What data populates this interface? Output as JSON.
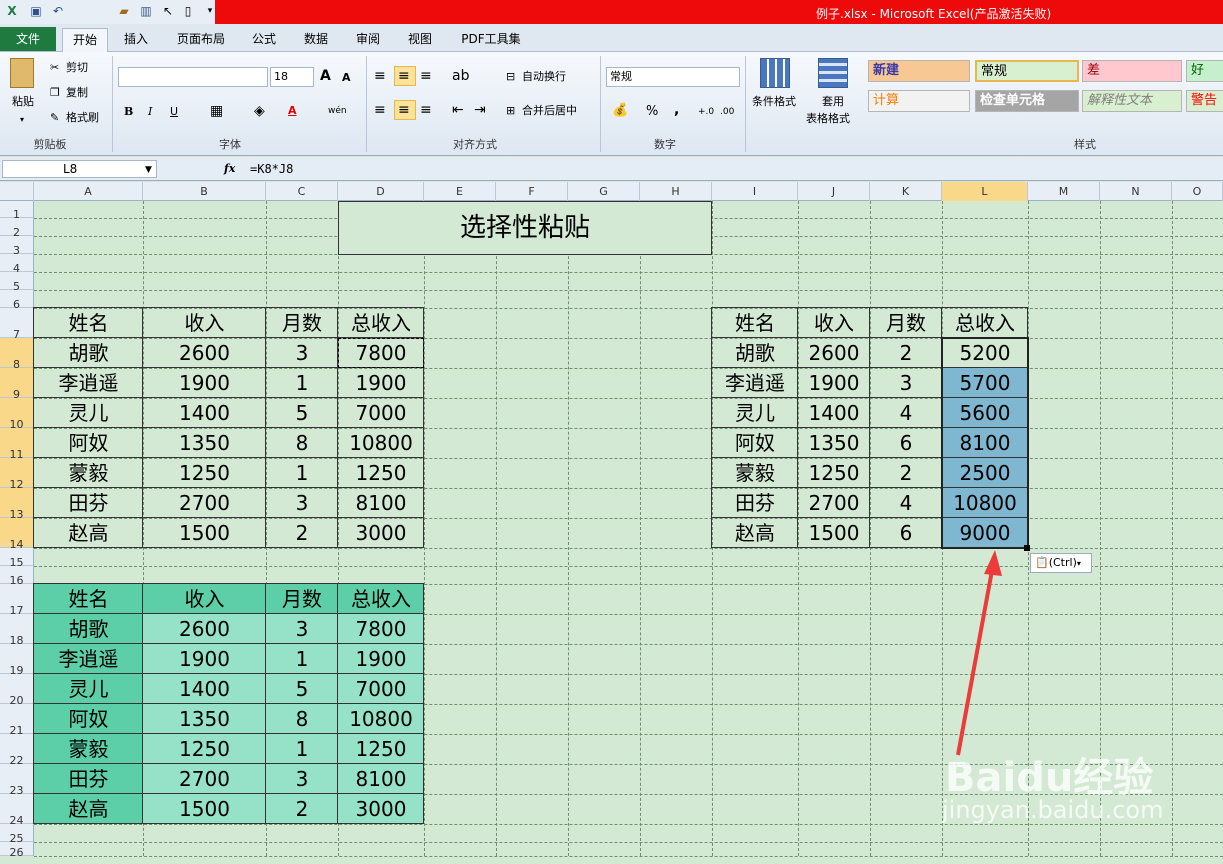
{
  "title_bar": {
    "text": "例子.xlsx - Microsoft Excel(产品激活失败)"
  },
  "tabs": [
    "文件",
    "开始",
    "插入",
    "页面布局",
    "公式",
    "数据",
    "审阅",
    "视图",
    "PDF工具集"
  ],
  "ribbon": {
    "clipboard": {
      "paste": "粘贴",
      "cut": "剪切",
      "copy": "复制",
      "format_painter": "格式刷",
      "label": "剪贴板"
    },
    "font": {
      "font_name": "",
      "font_size": "18",
      "label": "字体",
      "bold": "B",
      "italic": "I",
      "underline": "U",
      "grow": "A",
      "shrink": "A",
      "font_color": "A",
      "phonetic": "wén"
    },
    "alignment": {
      "wrap": "自动换行",
      "merge": "合并后居中",
      "label": "对齐方式"
    },
    "number": {
      "format": "常规",
      "percent": "%",
      "comma": ",",
      "label": "数字"
    },
    "styles": {
      "cond_format": "条件格式",
      "table_format_1": "套用",
      "table_format_2": "表格格式",
      "label": "样式",
      "cells": [
        {
          "text": "新建",
          "bg": "#f8c894",
          "fg": "#3a3aa8"
        },
        {
          "text": "常规",
          "bg": "#d9f0d0",
          "fg": "#000"
        },
        {
          "text": "差",
          "bg": "#ffc7ce",
          "fg": "#9c0006"
        },
        {
          "text": "好",
          "bg": "#c6efce",
          "fg": "#006100"
        },
        {
          "text": "计算",
          "bg": "#f2f2f2",
          "fg": "#fa7d00"
        },
        {
          "text": "检查单元格",
          "bg": "#a5a5a5",
          "fg": "#fff"
        },
        {
          "text": "解释性文本",
          "bg": "#d9f0d0",
          "fg": "#7f7f7f"
        },
        {
          "text": "警告",
          "bg": "#d9f0d0",
          "fg": "#ff0000"
        }
      ]
    }
  },
  "formula_bar": {
    "cell_ref": "L8",
    "fx": "fx",
    "formula": "=K8*J8"
  },
  "columns": [
    "A",
    "B",
    "C",
    "D",
    "E",
    "F",
    "G",
    "H",
    "I",
    "J",
    "K",
    "L",
    "M",
    "N",
    "O"
  ],
  "rows": [
    "1",
    "2",
    "3",
    "4",
    "5",
    "6",
    "7",
    "8",
    "9",
    "10",
    "11",
    "12",
    "13",
    "14",
    "15",
    "16",
    "17",
    "18",
    "19",
    "20",
    "21",
    "22",
    "23",
    "24",
    "25",
    "26"
  ],
  "sheet_title": "选择性粘贴",
  "table_headers": [
    "姓名",
    "收入",
    "月数",
    "总收入"
  ],
  "table1": [
    [
      "胡歌",
      "2600",
      "3",
      "7800"
    ],
    [
      "李逍遥",
      "1900",
      "1",
      "1900"
    ],
    [
      "灵儿",
      "1400",
      "5",
      "7000"
    ],
    [
      "阿奴",
      "1350",
      "8",
      "10800"
    ],
    [
      "蒙毅",
      "1250",
      "1",
      "1250"
    ],
    [
      "田芬",
      "2700",
      "3",
      "8100"
    ],
    [
      "赵高",
      "1500",
      "2",
      "3000"
    ]
  ],
  "table2": [
    [
      "胡歌",
      "2600",
      "2",
      "5200"
    ],
    [
      "李逍遥",
      "1900",
      "3",
      "5700"
    ],
    [
      "灵儿",
      "1400",
      "4",
      "5600"
    ],
    [
      "阿奴",
      "1350",
      "6",
      "8100"
    ],
    [
      "蒙毅",
      "1250",
      "2",
      "2500"
    ],
    [
      "田芬",
      "2700",
      "4",
      "10800"
    ],
    [
      "赵高",
      "1500",
      "6",
      "9000"
    ]
  ],
  "table3": [
    [
      "胡歌",
      "2600",
      "3",
      "7800"
    ],
    [
      "李逍遥",
      "1900",
      "1",
      "1900"
    ],
    [
      "灵儿",
      "1400",
      "5",
      "7000"
    ],
    [
      "阿奴",
      "1350",
      "8",
      "10800"
    ],
    [
      "蒙毅",
      "1250",
      "1",
      "1250"
    ],
    [
      "田芬",
      "2700",
      "3",
      "8100"
    ],
    [
      "赵高",
      "1500",
      "2",
      "3000"
    ]
  ],
  "paste_options": "(Ctrl)",
  "watermark": {
    "brand": "Baidu经验",
    "url": "jingyan.baidu.com"
  },
  "colors": {
    "accent_red": "#ee0a0a",
    "teal_header": "#5ccfa8",
    "teal_cell": "#96e2c8",
    "selection_blue": "#7fb6d0"
  }
}
